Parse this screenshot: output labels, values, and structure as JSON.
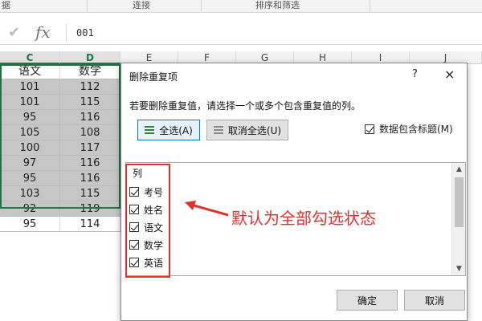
{
  "ribbon": {
    "groups": [
      "据",
      "连接",
      "排序和筛选"
    ]
  },
  "formula_bar": {
    "check_icon": "checkmark-icon",
    "fx_label": "fx",
    "formula_value": "001"
  },
  "columns": [
    "C",
    "D",
    "E",
    "F",
    "G",
    "H",
    "I",
    "J"
  ],
  "grid": {
    "headers": [
      "语文",
      "数学"
    ],
    "rows": [
      [
        "101",
        "112"
      ],
      [
        "101",
        "115"
      ],
      [
        "95",
        "116"
      ],
      [
        "105",
        "108"
      ],
      [
        "100",
        "117"
      ],
      [
        "97",
        "116"
      ],
      [
        "95",
        "116"
      ],
      [
        "103",
        "115"
      ],
      [
        "92",
        "119"
      ],
      [
        "95",
        "114"
      ]
    ]
  },
  "dialog": {
    "title": "删除重复项",
    "help": "?",
    "close": "×",
    "description": "若要删除重复值，请选择一个或多个包含重复值的列。",
    "select_all_label": "全选(A)",
    "unselect_all_label": "取消全选(U)",
    "header_option_label": "数据包含标题(M)",
    "list_title": "列",
    "list_items": [
      "考号",
      "姓名",
      "语文",
      "数学",
      "英语"
    ],
    "ok_label": "确定",
    "cancel_label": "取消"
  },
  "annotation": {
    "text": "默认为全部勾选状态",
    "color": "#e52e2e"
  },
  "colors": {
    "excel_green": "#217346",
    "shade": "#c6c6c6",
    "focus_blue": "#0078d7"
  }
}
